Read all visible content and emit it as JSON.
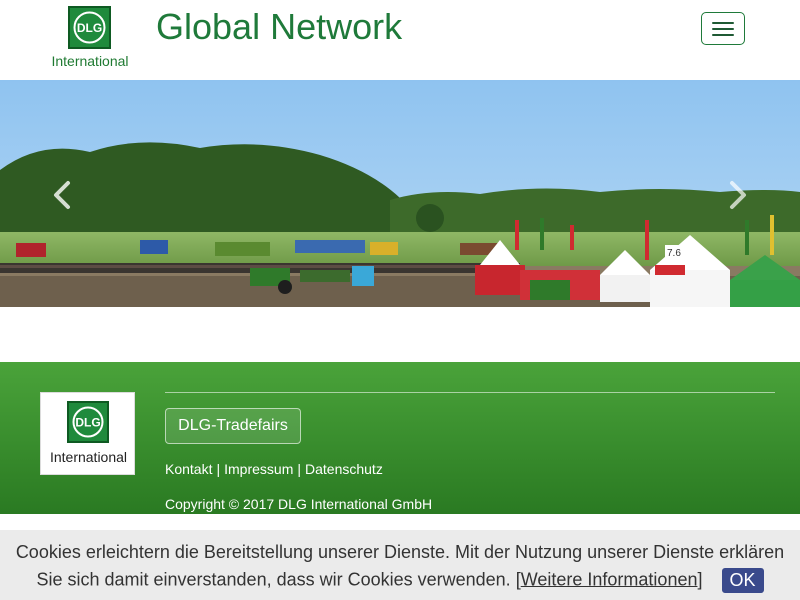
{
  "header": {
    "logo_text": "DLG",
    "logo_caption": "International",
    "site_title": "Global Network",
    "menu_toggle_icon": "hamburger-menu-icon"
  },
  "carousel": {
    "prev_icon": "chevron-left-icon",
    "next_icon": "chevron-right-icon"
  },
  "footer": {
    "logo_text": "DLG",
    "logo_caption": "International",
    "tradefairs_label": "DLG-Tradefairs",
    "links": [
      "Kontakt",
      "Impressum",
      "Datenschutz"
    ],
    "separator": "|",
    "copyright": "Copyright © 2017 DLG International GmbH"
  },
  "cookie": {
    "line1": "Cookies erleichtern die Bereitstellung unserer Dienste. Mit der Nutzung unserer Dienste erklären",
    "line2": "Sie sich damit einverstanden, dass wir Cookies verwenden.",
    "more_bracket_open": "[",
    "more_label": "Weitere Informationen",
    "more_bracket_close": "]",
    "ok_label": "OK"
  },
  "colors": {
    "brand_green": "#1f7a3a",
    "footer_green_top": "#4aa33a",
    "footer_green_bottom": "#2a7a22",
    "ok_button": "#3a4a8c"
  }
}
